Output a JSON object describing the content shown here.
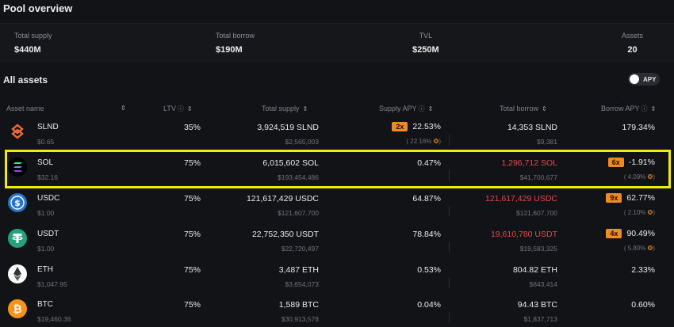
{
  "page_title": "Pool overview",
  "overview": {
    "stats": [
      {
        "label": "Total supply",
        "value": "$440M"
      },
      {
        "label": "Total borrow",
        "value": "$190M"
      },
      {
        "label": "TVL",
        "value": "$250M"
      },
      {
        "label": "Assets",
        "value": "20"
      }
    ]
  },
  "section_title": "All assets",
  "apy_toggle_label": "APY",
  "table": {
    "headers": {
      "asset": "Asset name",
      "ltv": "LTV",
      "total_supply": "Total supply",
      "supply_apy": "Supply APY",
      "total_borrow": "Total borrow",
      "borrow_apy": "Borrow APY"
    },
    "rows": [
      {
        "symbol": "SLND",
        "price": "$0.65",
        "ltv": "35%",
        "supply": "3,924,519 SLND",
        "supply_usd": "$2,565,003",
        "supply_badge": "2x",
        "supply_apy": "22.53%",
        "supply_apy_sub": "( 22.16%",
        "borrow": "14,353 SLND",
        "borrow_usd": "$9,381",
        "borrow_badge": "",
        "borrow_apy": "179.34%",
        "borrow_apy_sub": ""
      },
      {
        "symbol": "SOL",
        "price": "$32.16",
        "ltv": "75%",
        "supply": "6,015,602 SOL",
        "supply_usd": "$193,454,486",
        "supply_badge": "",
        "supply_apy": "0.47%",
        "supply_apy_sub": "",
        "borrow": "1,296,712 SOL",
        "borrow_usd": "$41,700,677",
        "borrow_badge": "6x",
        "borrow_apy": "-1.91%",
        "borrow_apy_sub": "( 4.09%"
      },
      {
        "symbol": "USDC",
        "price": "$1.00",
        "ltv": "75%",
        "supply": "121,617,429 USDC",
        "supply_usd": "$121,607,700",
        "supply_badge": "",
        "supply_apy": "64.87%",
        "supply_apy_sub": "",
        "borrow": "121,617,429 USDC",
        "borrow_usd": "$121,607,700",
        "borrow_badge": "9x",
        "borrow_apy": "62.77%",
        "borrow_apy_sub": "( 2.10%"
      },
      {
        "symbol": "USDT",
        "price": "$1.00",
        "ltv": "75%",
        "supply": "22,752,350 USDT",
        "supply_usd": "$22,720,497",
        "supply_badge": "",
        "supply_apy": "78.84%",
        "supply_apy_sub": "",
        "borrow": "19,610,780 USDT",
        "borrow_usd": "$19,583,325",
        "borrow_badge": "4x",
        "borrow_apy": "90.49%",
        "borrow_apy_sub": "( 5.80%"
      },
      {
        "symbol": "ETH",
        "price": "$1,047.95",
        "ltv": "75%",
        "supply": "3,487 ETH",
        "supply_usd": "$3,654,073",
        "supply_badge": "",
        "supply_apy": "0.53%",
        "supply_apy_sub": "",
        "borrow": "804.82 ETH",
        "borrow_usd": "$843,414",
        "borrow_badge": "",
        "borrow_apy": "2.33%",
        "borrow_apy_sub": ""
      },
      {
        "symbol": "BTC",
        "price": "$19,460.36",
        "ltv": "75%",
        "supply": "1,589 BTC",
        "supply_usd": "$30,913,578",
        "supply_badge": "",
        "supply_apy": "0.04%",
        "supply_apy_sub": "",
        "borrow": "94.43 BTC",
        "borrow_usd": "$1,837,713",
        "borrow_badge": "",
        "borrow_apy": "0.60%",
        "borrow_apy_sub": ""
      }
    ]
  },
  "colors": {
    "accent": "#f08a24",
    "borrow_red": "#e5484d",
    "highlight": "#f2ea0a"
  }
}
